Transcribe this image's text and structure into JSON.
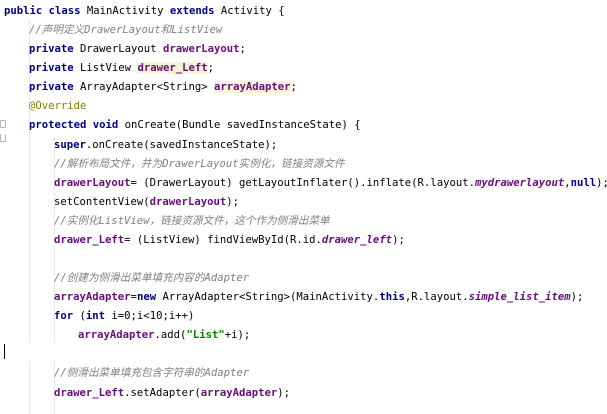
{
  "editor": {
    "lines": [
      {
        "id": "l1",
        "indent": 0,
        "tokens": [
          {
            "t": "kw",
            "v": "public class "
          },
          {
            "t": "cls",
            "v": "MainActivity "
          },
          {
            "t": "kw",
            "v": "extends "
          },
          {
            "t": "cls",
            "v": "Activity {"
          }
        ]
      },
      {
        "id": "l2",
        "indent": 1,
        "tokens": [
          {
            "t": "comment",
            "v": "//声明定义DrawerLayout和ListView"
          }
        ]
      },
      {
        "id": "l3",
        "indent": 1,
        "tokens": [
          {
            "t": "kw",
            "v": "private "
          },
          {
            "t": "cls",
            "v": "DrawerLayout "
          },
          {
            "t": "field",
            "v": "drawerLayout"
          },
          {
            "t": "cls",
            "v": ";"
          }
        ]
      },
      {
        "id": "l4",
        "indent": 1,
        "tokens": [
          {
            "t": "kw",
            "v": "private "
          },
          {
            "t": "cls",
            "v": "ListView "
          },
          {
            "t": "field-hl",
            "v": "drawer_Left"
          },
          {
            "t": "cls",
            "v": ";"
          }
        ]
      },
      {
        "id": "l5",
        "indent": 1,
        "tokens": [
          {
            "t": "kw",
            "v": "private "
          },
          {
            "t": "cls",
            "v": "ArrayAdapter<String> "
          },
          {
            "t": "field-hl",
            "v": "arrayAdapter"
          },
          {
            "t": "cls",
            "v": ";"
          }
        ]
      },
      {
        "id": "l6",
        "indent": 1,
        "tokens": [
          {
            "t": "anno",
            "v": "@Override"
          }
        ]
      },
      {
        "id": "l7",
        "indent": 1,
        "tokens": [
          {
            "t": "kw",
            "v": "protected void "
          },
          {
            "t": "cls",
            "v": "onCreate(Bundle savedInstanceState) {"
          }
        ]
      },
      {
        "id": "l8",
        "indent": 2,
        "tokens": [
          {
            "t": "kw",
            "v": "super"
          },
          {
            "t": "cls",
            "v": ".onCreate(savedInstanceState);"
          }
        ]
      },
      {
        "id": "l9",
        "indent": 2,
        "tokens": [
          {
            "t": "comment",
            "v": "//解析布局文件，并为DrawerLayout实例化，链接资源文件"
          }
        ]
      },
      {
        "id": "l10",
        "indent": 2,
        "tokens": [
          {
            "t": "field",
            "v": "drawerLayout"
          },
          {
            "t": "cls",
            "v": "= (DrawerLayout) getLayoutInflater().inflate(R.layout."
          },
          {
            "t": "static",
            "v": "mydrawerlayout"
          },
          {
            "t": "cls",
            "v": ","
          },
          {
            "t": "kw",
            "v": "null"
          },
          {
            "t": "cls",
            "v": ");"
          }
        ]
      },
      {
        "id": "l11",
        "indent": 2,
        "tokens": [
          {
            "t": "cls",
            "v": "setContentView("
          },
          {
            "t": "field",
            "v": "drawerLayout"
          },
          {
            "t": "cls",
            "v": ");"
          }
        ]
      },
      {
        "id": "l12",
        "indent": 2,
        "tokens": [
          {
            "t": "comment",
            "v": "//实例化ListView，链接资源文件，这个作为侧滑出菜单"
          }
        ]
      },
      {
        "id": "l13",
        "indent": 2,
        "tokens": [
          {
            "t": "field",
            "v": "drawer_Left"
          },
          {
            "t": "cls",
            "v": "= (ListView) findViewById(R.id."
          },
          {
            "t": "static",
            "v": "drawer_left"
          },
          {
            "t": "cls",
            "v": ");"
          }
        ]
      },
      {
        "id": "l14",
        "indent": 0,
        "tokens": []
      },
      {
        "id": "l15",
        "indent": 2,
        "tokens": [
          {
            "t": "comment",
            "v": "//创建为侧滑出菜单填充内容的Adapter"
          }
        ]
      },
      {
        "id": "l16",
        "indent": 2,
        "tokens": [
          {
            "t": "field",
            "v": "arrayAdapter"
          },
          {
            "t": "cls",
            "v": "="
          },
          {
            "t": "kw",
            "v": "new "
          },
          {
            "t": "cls",
            "v": "ArrayAdapter<String>(MainActivity."
          },
          {
            "t": "kw",
            "v": "this"
          },
          {
            "t": "cls",
            "v": ",R.layout."
          },
          {
            "t": "static",
            "v": "simple_list_item"
          },
          {
            "t": "cls",
            "v": ");"
          }
        ]
      },
      {
        "id": "l17",
        "indent": 2,
        "tokens": [
          {
            "t": "kw",
            "v": "for "
          },
          {
            "t": "cls",
            "v": "("
          },
          {
            "t": "kw",
            "v": "int "
          },
          {
            "t": "cls",
            "v": "i=0;i<10;i++)"
          }
        ]
      },
      {
        "id": "l18",
        "indent": 3,
        "tokens": [
          {
            "t": "field",
            "v": "arrayAdapter"
          },
          {
            "t": "cls",
            "v": ".add("
          },
          {
            "t": "str",
            "v": "\"List\""
          },
          {
            "t": "cls",
            "v": "+i);"
          }
        ]
      },
      {
        "id": "l19",
        "indent": 0,
        "tokens": []
      },
      {
        "id": "l20",
        "indent": 2,
        "tokens": [
          {
            "t": "comment",
            "v": "//侧滑出菜单填充包含字符串的Adapter"
          }
        ]
      },
      {
        "id": "l21",
        "indent": 2,
        "tokens": [
          {
            "t": "field",
            "v": "drawer_Left"
          },
          {
            "t": "cls",
            "v": ".setAdapter("
          },
          {
            "t": "field",
            "v": "arrayAdapter"
          },
          {
            "t": "cls",
            "v": ");"
          }
        ]
      }
    ]
  }
}
